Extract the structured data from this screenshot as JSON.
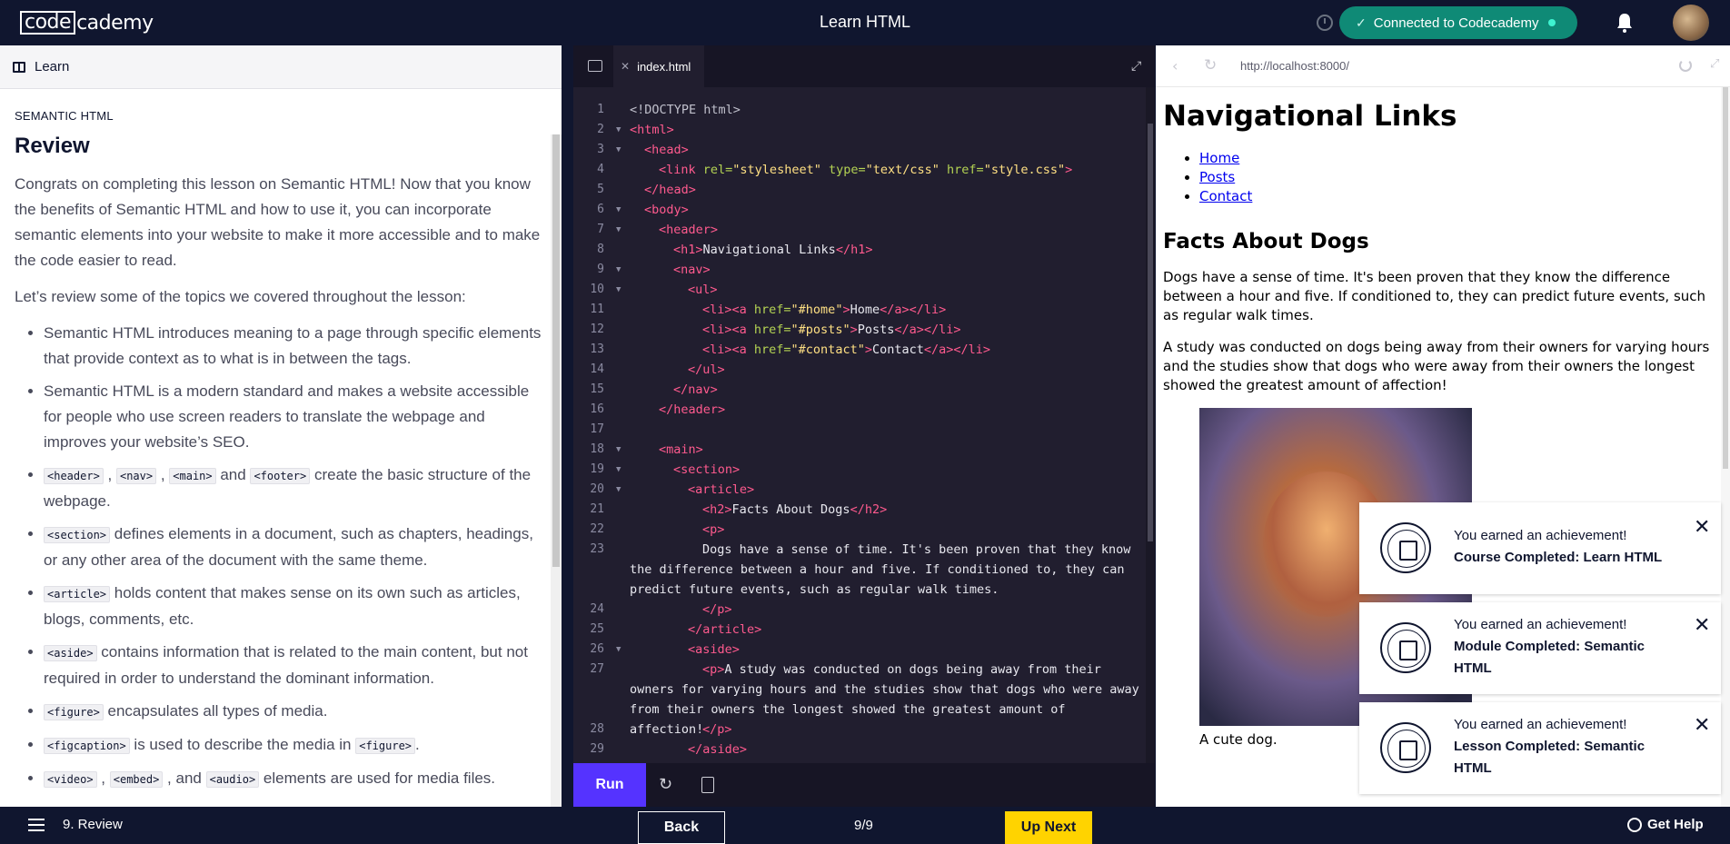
{
  "topbar": {
    "logo_box": "code",
    "logo_rest": "cademy",
    "title": "Learn HTML",
    "connected_label": "Connected to Codecademy"
  },
  "learn_panel": {
    "header_label": "Learn",
    "eyebrow": "SEMANTIC HTML",
    "title": "Review",
    "intro": "Congrats on completing this lesson on Semantic HTML! Now that you know the benefits of Semantic HTML and how to use it, you can incorporate semantic elements into your website to make it more accessible and to make the code easier to read.",
    "review_lead": "Let’s review some of the topics we covered throughout the lesson:",
    "bullets": [
      {
        "text": "Semantic HTML introduces meaning to a page through specific elements that provide context as to what is in between the tags."
      },
      {
        "text": "Semantic HTML is a modern standard and makes a website accessible for people who use screen readers to translate the webpage and improves your website’s SEO."
      },
      {
        "codes": [
          "<header>",
          "<nav>",
          "<main>",
          "<footer>"
        ],
        "sep1": " , ",
        "sep2": " , ",
        "sep3": " and ",
        "text": " create the basic structure of the webpage."
      },
      {
        "code": "<section>",
        "text": " defines elements in a document, such as chapters, headings, or any other area of the document with the same theme."
      },
      {
        "code": "<article>",
        "text": " holds content that makes sense on its own such as articles, blogs, comments, etc."
      },
      {
        "code": "<aside>",
        "text": " contains information that is related to the main content, but not required in order to understand the dominant information."
      },
      {
        "code": "<figure>",
        "text": " encapsulates all types of media."
      },
      {
        "code": "<figcaption>",
        "text": " is used to describe the media in ",
        "code2": "<figure>",
        "tail": "."
      },
      {
        "codes": [
          "<video>",
          "<embed>",
          "<audio>"
        ],
        "sep1": " , ",
        "sep2": " , and ",
        "text": " elements are used for media files."
      }
    ]
  },
  "editor": {
    "tab_label": "index.html",
    "run_label": "Run",
    "lines": [
      {
        "n": "1",
        "fold": false,
        "indent": 0,
        "segs": [
          [
            "doc",
            "<!DOCTYPE html>"
          ]
        ]
      },
      {
        "n": "2",
        "fold": true,
        "indent": 0,
        "segs": [
          [
            "tag",
            "<html>"
          ]
        ]
      },
      {
        "n": "3",
        "fold": true,
        "indent": 1,
        "segs": [
          [
            "tag",
            "<head>"
          ]
        ]
      },
      {
        "n": "4",
        "fold": false,
        "indent": 2,
        "segs": [
          [
            "tag",
            "<link "
          ],
          [
            "attr",
            "rel="
          ],
          [
            "str",
            "\"stylesheet\""
          ],
          [
            "attr",
            " type="
          ],
          [
            "str",
            "\"text/css\""
          ],
          [
            "attr",
            " href="
          ],
          [
            "str",
            "\"style.css\""
          ],
          [
            "tag",
            ">"
          ]
        ]
      },
      {
        "n": "5",
        "fold": false,
        "indent": 1,
        "segs": [
          [
            "tag",
            "</head>"
          ]
        ]
      },
      {
        "n": "6",
        "fold": true,
        "indent": 1,
        "segs": [
          [
            "tag",
            "<body>"
          ]
        ]
      },
      {
        "n": "7",
        "fold": true,
        "indent": 2,
        "segs": [
          [
            "tag",
            "<header>"
          ]
        ]
      },
      {
        "n": "8",
        "fold": false,
        "indent": 3,
        "segs": [
          [
            "tag",
            "<h1>"
          ],
          [
            "txt",
            "Navigational Links"
          ],
          [
            "tag",
            "</h1>"
          ]
        ]
      },
      {
        "n": "9",
        "fold": true,
        "indent": 3,
        "segs": [
          [
            "tag",
            "<nav>"
          ]
        ]
      },
      {
        "n": "10",
        "fold": true,
        "indent": 4,
        "segs": [
          [
            "tag",
            "<ul>"
          ]
        ]
      },
      {
        "n": "11",
        "fold": false,
        "indent": 5,
        "segs": [
          [
            "tag",
            "<li><a "
          ],
          [
            "attr",
            "href="
          ],
          [
            "str",
            "\"#home\""
          ],
          [
            "tag",
            ">"
          ],
          [
            "txt",
            "Home"
          ],
          [
            "tag",
            "</a></li>"
          ]
        ]
      },
      {
        "n": "12",
        "fold": false,
        "indent": 5,
        "segs": [
          [
            "tag",
            "<li><a "
          ],
          [
            "attr",
            "href="
          ],
          [
            "str",
            "\"#posts\""
          ],
          [
            "tag",
            ">"
          ],
          [
            "txt",
            "Posts"
          ],
          [
            "tag",
            "</a></li>"
          ]
        ]
      },
      {
        "n": "13",
        "fold": false,
        "indent": 5,
        "segs": [
          [
            "tag",
            "<li><a "
          ],
          [
            "attr",
            "href="
          ],
          [
            "str",
            "\"#contact\""
          ],
          [
            "tag",
            ">"
          ],
          [
            "txt",
            "Contact"
          ],
          [
            "tag",
            "</a></li>"
          ]
        ]
      },
      {
        "n": "14",
        "fold": false,
        "indent": 4,
        "segs": [
          [
            "tag",
            "</ul>"
          ]
        ]
      },
      {
        "n": "15",
        "fold": false,
        "indent": 3,
        "segs": [
          [
            "tag",
            "</nav>"
          ]
        ]
      },
      {
        "n": "16",
        "fold": false,
        "indent": 2,
        "segs": [
          [
            "tag",
            "</header>"
          ]
        ]
      },
      {
        "n": "17",
        "fold": false,
        "indent": 0,
        "segs": []
      },
      {
        "n": "18",
        "fold": true,
        "indent": 2,
        "segs": [
          [
            "tag",
            "<main>"
          ]
        ]
      },
      {
        "n": "19",
        "fold": true,
        "indent": 3,
        "segs": [
          [
            "tag",
            "<section>"
          ]
        ]
      },
      {
        "n": "20",
        "fold": true,
        "indent": 4,
        "segs": [
          [
            "tag",
            "<article>"
          ]
        ]
      },
      {
        "n": "21",
        "fold": false,
        "indent": 5,
        "segs": [
          [
            "tag",
            "<h2>"
          ],
          [
            "txt",
            "Facts About Dogs"
          ],
          [
            "tag",
            "</h2>"
          ]
        ]
      },
      {
        "n": "22",
        "fold": false,
        "indent": 5,
        "segs": [
          [
            "tag",
            "<p>"
          ]
        ]
      },
      {
        "n": "23",
        "fold": false,
        "indent": 5,
        "tall": true,
        "segs": [
          [
            "txt",
            "Dogs have a sense of time. It's been proven that they know the difference between a hour and five. If conditioned to, they can predict future events, such as regular walk times."
          ]
        ]
      },
      {
        "n": "24",
        "fold": false,
        "indent": 5,
        "segs": [
          [
            "tag",
            "</p>"
          ]
        ]
      },
      {
        "n": "25",
        "fold": false,
        "indent": 4,
        "segs": [
          [
            "tag",
            "</article>"
          ]
        ]
      },
      {
        "n": "26",
        "fold": true,
        "indent": 4,
        "segs": [
          [
            "tag",
            "<aside>"
          ]
        ]
      },
      {
        "n": "27",
        "fold": false,
        "indent": 5,
        "tall": true,
        "segs": [
          [
            "tag",
            "<p>"
          ],
          [
            "txt",
            "A study was conducted on dogs being away from their owners for varying hours and the studies show that dogs who were away from their owners the longest showed the greatest amount of affection!"
          ]
        ]
      },
      {
        "n": "28",
        "fold": false,
        "indent": 5,
        "segs": [
          [
            "tag",
            "</p>"
          ]
        ]
      },
      {
        "n": "29",
        "fold": false,
        "indent": 4,
        "segs": [
          [
            "tag",
            "</aside>"
          ]
        ]
      }
    ]
  },
  "browser": {
    "url": "http://localhost:8000/",
    "page_h1": "Navigational Links",
    "links": [
      "Home",
      "Posts",
      "Contact"
    ],
    "page_h2": "Facts About Dogs",
    "para1": "Dogs have a sense of time. It's been proven that they know the difference between a hour and five. If conditioned to, they can predict future events, such as regular walk times.",
    "para2": "A study was conducted on dogs being away from their owners for varying hours and the studies show that dogs who were away from their owners the longest showed the greatest amount of affection!",
    "caption": "A cute dog."
  },
  "toasts": [
    {
      "line1": "You earned an achievement!",
      "line2": "Course Completed: Learn HTML"
    },
    {
      "line1": "You earned an achievement!",
      "line2": "Module Completed: Semantic HTML"
    },
    {
      "line1": "You earned an achievement!",
      "line2": "Lesson Completed: Semantic HTML"
    }
  ],
  "bottombar": {
    "crumb": "9. Review",
    "back_label": "Back",
    "counter": "9/9",
    "next_label": "Up Next",
    "help_label": "Get Help"
  },
  "colors": {
    "nav_bg": "#10162f",
    "editor_bg": "#211e2f",
    "run_button": "#5533ff",
    "connected_pill": "#0f8a76",
    "up_next": "#ffd300"
  }
}
